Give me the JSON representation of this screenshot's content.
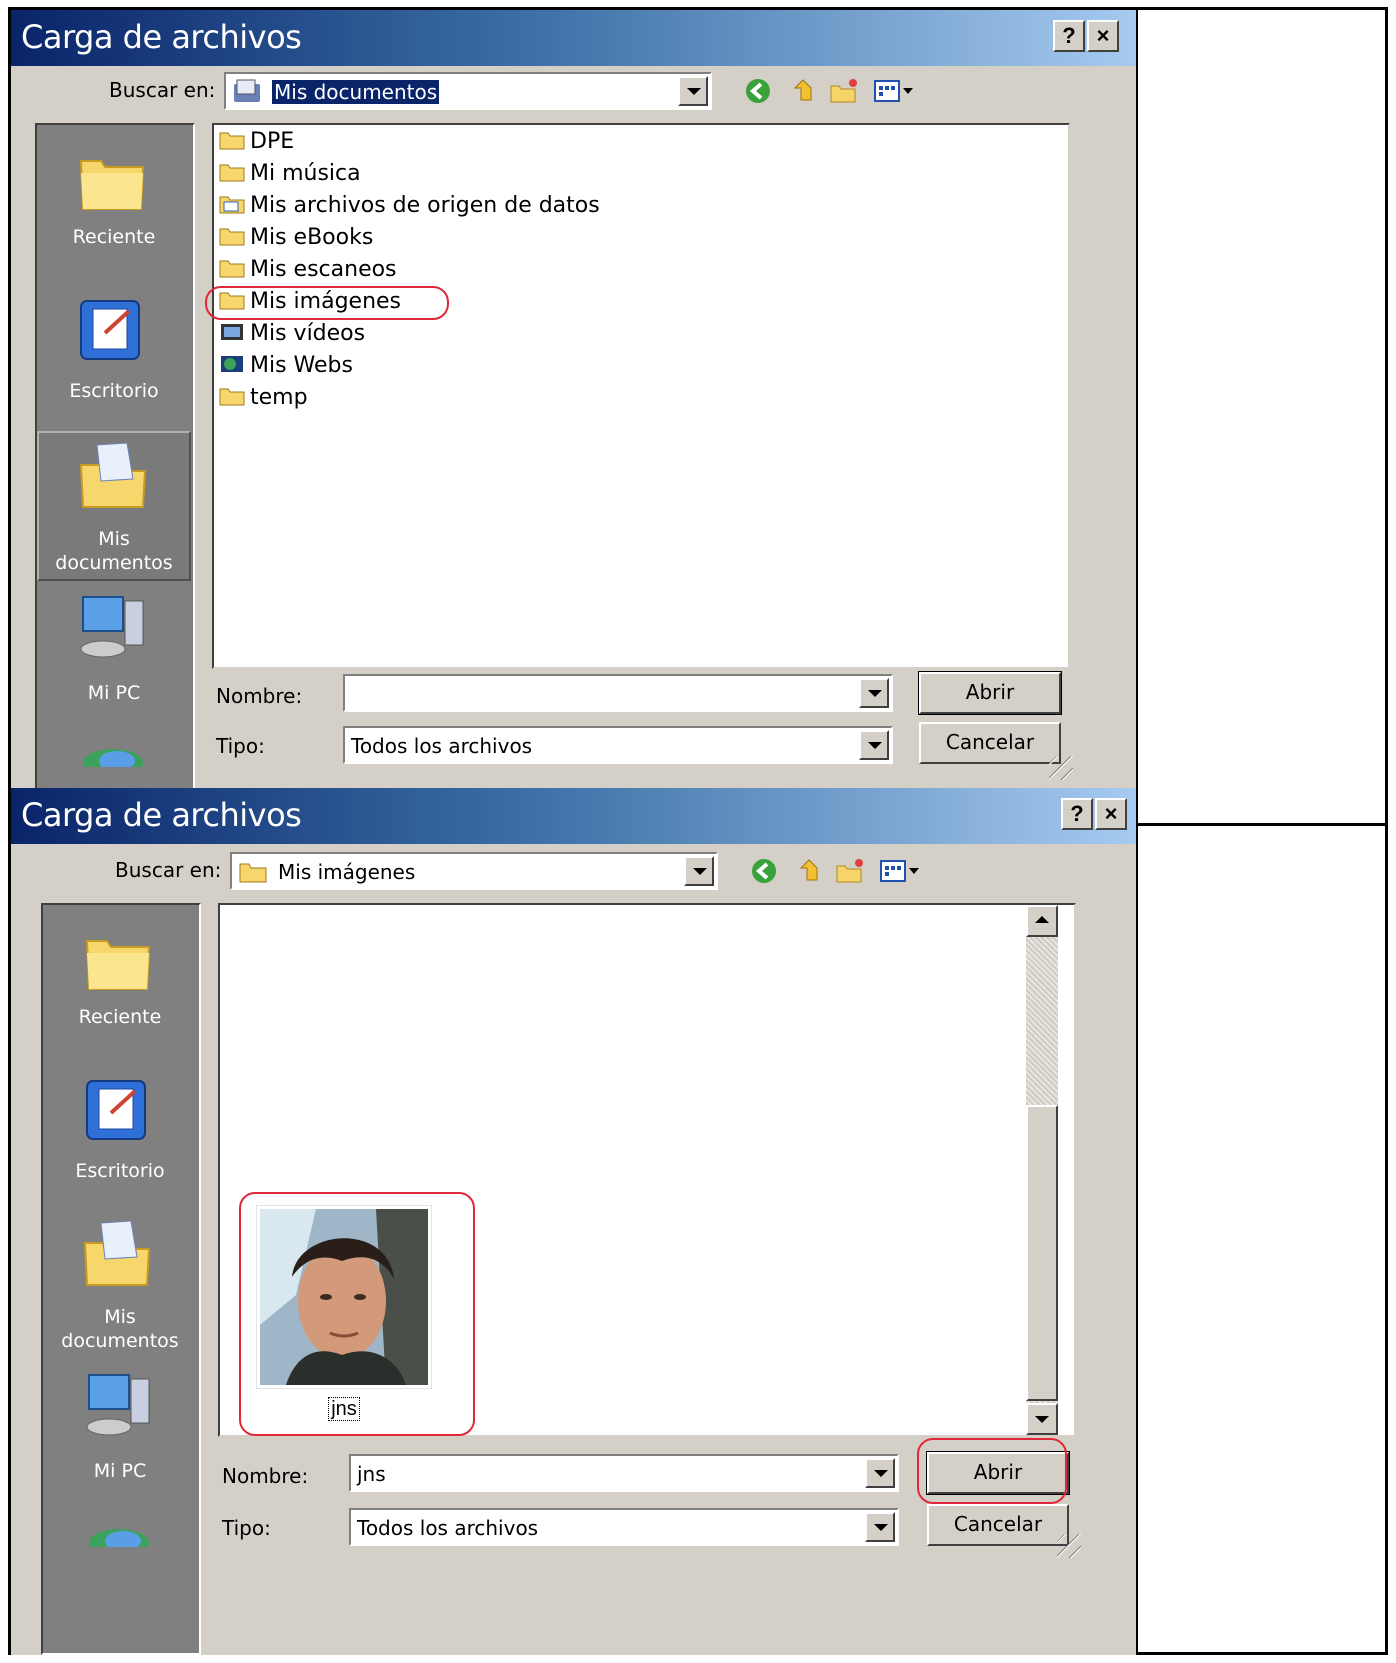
{
  "dialog1": {
    "title": "Carga de archivos",
    "help_label": "?",
    "close_label": "×",
    "look_in_label": "Buscar en:",
    "look_in_value": "Mis documentos",
    "places": [
      "Reciente",
      "Escritorio",
      "Mis documentos",
      "Mi PC"
    ],
    "files": [
      {
        "name": "DPE",
        "icon": "folder-icon"
      },
      {
        "name": "Mi música",
        "icon": "folder-icon"
      },
      {
        "name": "Mis archivos de origen de datos",
        "icon": "data-source-folder-icon"
      },
      {
        "name": "Mis eBooks",
        "icon": "folder-icon"
      },
      {
        "name": "Mis escaneos",
        "icon": "folder-icon"
      },
      {
        "name": "Mis imágenes",
        "icon": "folder-icon"
      },
      {
        "name": "Mis vídeos",
        "icon": "video-folder-icon"
      },
      {
        "name": "Mis Webs",
        "icon": "web-folder-icon"
      },
      {
        "name": "temp",
        "icon": "folder-icon"
      }
    ],
    "name_label": "Nombre:",
    "name_value": "",
    "type_label": "Tipo:",
    "type_value": "Todos los archivos",
    "open_label": "Abrir",
    "cancel_label": "Cancelar"
  },
  "dialog2": {
    "title": "Carga de archivos",
    "help_label": "?",
    "close_label": "×",
    "look_in_label": "Buscar en:",
    "look_in_value": "Mis imágenes",
    "places": [
      "Reciente",
      "Escritorio",
      "Mis documentos",
      "Mi PC"
    ],
    "thumbnail_name": "jns",
    "name_label": "Nombre:",
    "name_value": "jns",
    "type_label": "Tipo:",
    "type_value": "Todos los archivos",
    "open_label": "Abrir",
    "cancel_label": "Cancelar"
  },
  "colors": {
    "title_gradient_start": "#0a246a",
    "title_gradient_end": "#a6caf0",
    "dialog_face": "#d4d0c8",
    "highlight_red": "#e0283a"
  }
}
